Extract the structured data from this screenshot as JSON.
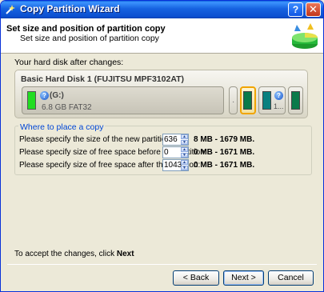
{
  "window": {
    "title": "Copy Partition Wizard",
    "help_glyph": "?",
    "close_glyph": "✕"
  },
  "header": {
    "title": "Set size and position of partition copy",
    "subtitle": "Set size and position of partition copy"
  },
  "disk_section": {
    "label": "Your hard disk after changes:"
  },
  "disk": {
    "title": "Basic Hard Disk 1 (FUJITSU MPF3102AT)",
    "partitions": [
      {
        "name": "(G:)",
        "info": "6.8 GB FAT32",
        "color": "#22dd22",
        "icon": "question-icon"
      },
      {
        "name": "·",
        "info": ""
      },
      {
        "name": "",
        "info": "",
        "color": "#0a7a4a"
      },
      {
        "name": "",
        "info": "1...",
        "color": "#0a8080",
        "icon": "question-icon"
      },
      {
        "name": "",
        "info": "",
        "color": "#0a7a4a"
      }
    ]
  },
  "placement": {
    "title": "Where to place a copy",
    "rows": [
      {
        "label": "Please specify the size of the new partition:",
        "value": "636",
        "range": "8 MB - 1679 MB."
      },
      {
        "label": "Please specify size of free space before the partition:",
        "value": "0",
        "range": "0 MB - 1671 MB."
      },
      {
        "label": "Please specify size of free space after the partition:",
        "value": "1043",
        "range": "0 MB - 1671 MB."
      }
    ]
  },
  "footer": {
    "hint_prefix": "To accept the changes, click ",
    "hint_bold": "Next"
  },
  "buttons": {
    "back": "< Back",
    "next": "Next >",
    "cancel": "Cancel"
  },
  "colors": {
    "titlebar": "#0b4fd0",
    "accent": "#0046d5"
  }
}
